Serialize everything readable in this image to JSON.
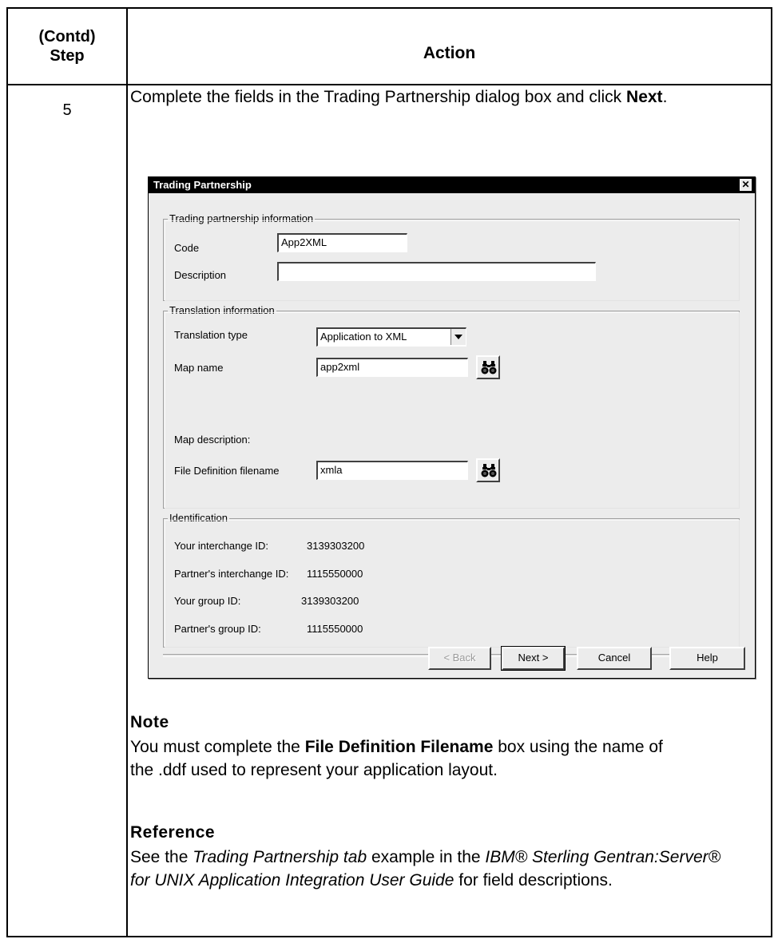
{
  "table": {
    "header_step_line1": "(Contd)",
    "header_step_line2": "Step",
    "header_action": "Action",
    "step_number": "5"
  },
  "intro": {
    "text_before": "Complete the fields in the Trading Partnership dialog box and click ",
    "bold": "Next",
    "text_after": "."
  },
  "dialog": {
    "title": "Trading Partnership",
    "close_glyph": "✕",
    "partnership_group": {
      "legend": "Trading partnership information",
      "code_label": "Code",
      "code_value": "App2XML",
      "description_label": "Description",
      "description_value": ""
    },
    "translation_group": {
      "legend": "Translation information",
      "type_label": "Translation type",
      "type_value": "Application to XML",
      "map_name_label": "Map name",
      "map_name_value": "app2xml",
      "map_description_label": "Map description:",
      "file_def_label": "File Definition filename",
      "file_def_value": "xmla"
    },
    "identification_group": {
      "legend": "Identification",
      "rows": [
        {
          "label": "Your interchange ID:",
          "value": "3139303200"
        },
        {
          "label": "Partner's interchange ID:",
          "value": "1115550000"
        },
        {
          "label": "Your group ID:",
          "value": "3139303200"
        },
        {
          "label": "Partner's group ID:",
          "value": "1115550000"
        }
      ]
    },
    "buttons": {
      "back": "< Back",
      "next": "Next >",
      "cancel": "Cancel",
      "help": "Help"
    }
  },
  "note": {
    "heading": "Note",
    "text_before": "You must complete the ",
    "bold": "File Definition Filename",
    "text_after": " box using the name of the .ddf used to represent your application layout."
  },
  "reference": {
    "heading": "Reference",
    "t1": "See the ",
    "i1": "Trading Partnership tab",
    "t2": " example in the ",
    "i2": "IBM® Sterling Gentran:Server® for UNIX Application Integration User Guide",
    "t3": " for field descriptions."
  }
}
